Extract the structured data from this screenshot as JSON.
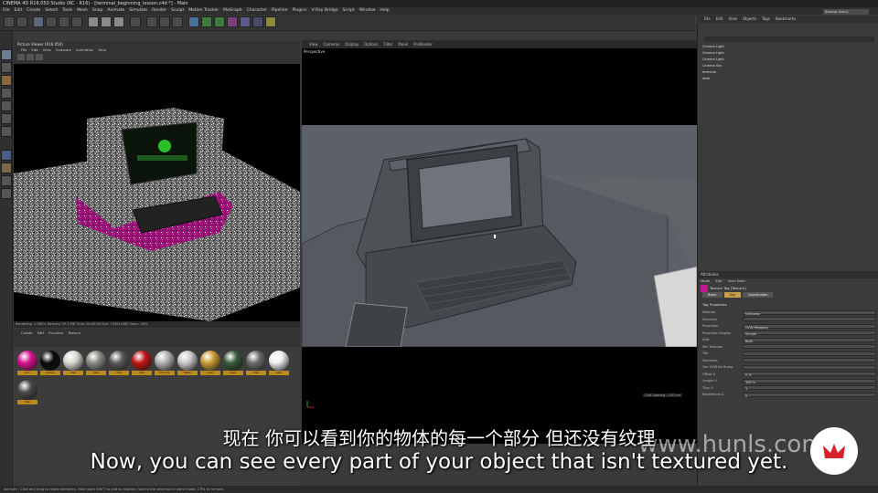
{
  "window": {
    "title": "CINEMA 4D R16.050 Studio (RC - R16) - [terminal_beginning_lesson.c4d *] - Main"
  },
  "menu": [
    "File",
    "Edit",
    "Create",
    "Select",
    "Tools",
    "Mesh",
    "Snap",
    "Animate",
    "Simulate",
    "Render",
    "Sculpt",
    "Motion Tracker",
    "MoGraph",
    "Character",
    "Pipeline",
    "Plugins",
    "V-Ray Bridge",
    "Script",
    "Window",
    "Help"
  ],
  "layout": {
    "label": "Layout:",
    "value": "Startup (User)"
  },
  "render_view": {
    "title": "Picture Viewer (R16.050)",
    "menu": [
      "File",
      "Edit",
      "View",
      "Compare",
      "Animation",
      "Help"
    ],
    "status": "Rendering: 1.000%   Memory: 93.2 MB   Time: 00:00:04   Size: 1920x1080   Zoom: 16%"
  },
  "material_manager": {
    "menu": [
      "Create",
      "Edit",
      "Function",
      "Texture"
    ],
    "materials": [
      {
        "name": "Scrn",
        "color": "#d6128c"
      },
      {
        "name": "Screen",
        "color": "#0a0a0a"
      },
      {
        "name": "Mat",
        "color": "#d8d8d0"
      },
      {
        "name": "Mat",
        "color": "#8a8a84"
      },
      {
        "name": "Mat",
        "color": "#5a5a5a"
      },
      {
        "name": "Mat",
        "color": "#c01414"
      },
      {
        "name": "Chrome",
        "color": "#b0b0b0"
      },
      {
        "name": "Metal",
        "color": "#c8c8c8"
      },
      {
        "name": "Gold",
        "color": "#c89a30"
      },
      {
        "name": "Keys",
        "color": "#3a5a3a"
      },
      {
        "name": "Mat",
        "color": "#6a6a6a"
      },
      {
        "name": "Mat",
        "color": "#eeeeee"
      },
      {
        "name": "Mat",
        "color": "#4a4a4a"
      }
    ]
  },
  "viewport": {
    "menu": [
      "View",
      "Cameras",
      "Display",
      "Options",
      "Filter",
      "Panel",
      "ProRender"
    ],
    "label": "Perspective",
    "grid_spacing": "Grid Spacing : 100 cm"
  },
  "object_manager": {
    "menu": [
      "File",
      "Edit",
      "View",
      "Objects",
      "Tags",
      "Bookmarks"
    ],
    "objects": [
      "Cinema Light",
      "Cinema Light",
      "Cinema Light",
      "Cinema Sky",
      "terminal",
      "desk"
    ]
  },
  "attributes": {
    "header": "Attributes",
    "menu": [
      "Mode",
      "Edit",
      "User Data"
    ],
    "tag_title": "Texture Tag [Texture]",
    "tabs": [
      "Basic",
      "Tag",
      "Coordinates"
    ],
    "active_tab": "Tag",
    "section": "Tag Properties",
    "rows": [
      {
        "label": "Material",
        "value": "Unknown"
      },
      {
        "label": "Selection",
        "value": ""
      },
      {
        "label": "Projection",
        "value": "UVW Mapping"
      },
      {
        "label": "Projection Display",
        "value": "Simple"
      },
      {
        "label": "Side",
        "value": "Both"
      },
      {
        "label": "Mix Textures",
        "value": ""
      },
      {
        "label": "Tile",
        "value": ""
      },
      {
        "label": "Seamless",
        "value": ""
      },
      {
        "label": "Use UVW for Bump",
        "value": ""
      },
      {
        "label": "Offset U",
        "value": "0 %"
      },
      {
        "label": "Length U",
        "value": "100 %"
      },
      {
        "label": "Tiles U",
        "value": "1"
      },
      {
        "label": "Repetitions U",
        "value": "0"
      }
    ]
  },
  "statusbar": "Azimuth : Click and drag to rotate elements. Hold down SHIFT to add to rotation; hold to the selection in point mode, CTRL to remove.",
  "subtitles": {
    "cn": "现在 你可以看到你的物体的每一个部分 但还没有纹理",
    "en": "Now, you can see every part of your object that isn't textured yet."
  },
  "watermark": "www.hunls.com"
}
